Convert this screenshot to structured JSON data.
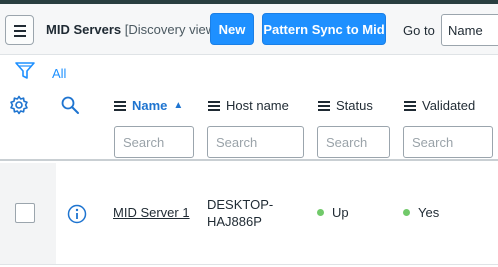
{
  "header": {
    "title": "MID Servers",
    "view": "[Discovery view]",
    "new_label": "New",
    "pattern_sync_label": "Pattern Sync to Mid",
    "goto_label": "Go to",
    "goto_selected": "Name"
  },
  "filter": {
    "breadcrumb": "All"
  },
  "columns": [
    {
      "label": "Name",
      "sorted": "ascending"
    },
    {
      "label": "Host name"
    },
    {
      "label": "Status"
    },
    {
      "label": "Validated"
    }
  ],
  "search": {
    "placeholder": "Search"
  },
  "rows": [
    {
      "name": "MID Server 1",
      "host_line1": "DESKTOP-",
      "host_line2": "HAJ886P",
      "status": "Up",
      "validated": "Yes"
    }
  ],
  "colors": {
    "accent": "#1e90ff",
    "status_up": "#71c96a"
  },
  "icons": [
    "hamburger-menu-icon",
    "filter-icon",
    "gear-icon",
    "search-icon",
    "info-icon",
    "column-menu-icon",
    "sort-ascending-icon"
  ]
}
